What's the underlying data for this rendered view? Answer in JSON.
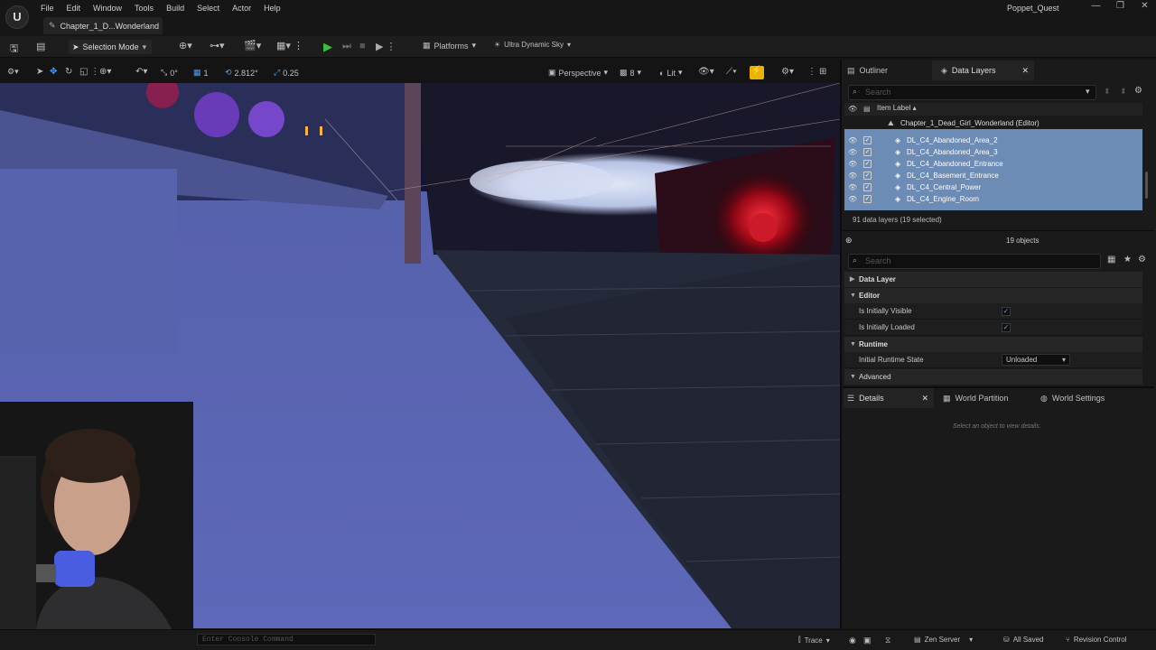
{
  "app": {
    "project_name": "Poppet_Quest",
    "level_tab": "Chapter_1_D...Wonderland",
    "logo_icon": "unreal-logo"
  },
  "menu": [
    "File",
    "Edit",
    "Window",
    "Tools",
    "Build",
    "Select",
    "Actor",
    "Help"
  ],
  "toolbar": {
    "selection_mode": "Selection Mode",
    "platforms": "Platforms",
    "sky": "Ultra Dynamic Sky"
  },
  "viewport_toolbar": {
    "rotation_snap": "0°",
    "grid_snap": "1",
    "angle_snap": "2.812°",
    "scale_snap": "0.25",
    "perspective": "Perspective",
    "camera_speed": "8",
    "view_mode": "Lit"
  },
  "outliner_tabs": {
    "outliner": "Outliner",
    "data_layers": "Data Layers"
  },
  "data_layers": {
    "search_placeholder": "Search",
    "column": "Item Label ▴",
    "world": "Chapter_1_Dead_Girl_Wonderland (Editor)",
    "items": [
      "DL_C4_Abandoned_Area_2",
      "DL_C4_Abandoned_Area_3",
      "DL_C4_Abandoned_Entrance",
      "DL_C4_Basement_Entrance",
      "DL_C4_Central_Power",
      "DL_C4_Engine_Room"
    ],
    "status": "91 data layers (19 selected)"
  },
  "layer_details": {
    "objects": "19 objects",
    "search_placeholder": "Search",
    "cat_data_layer": "Data Layer",
    "cat_editor": "Editor",
    "prop_visible": "Is Initially Visible",
    "prop_loaded": "Is Initially Loaded",
    "cat_runtime": "Runtime",
    "prop_runtime_state": "Initial Runtime State",
    "runtime_state_value": "Unloaded",
    "cat_advanced": "Advanced"
  },
  "details_tabs": {
    "details": "Details",
    "world_partition": "World Partition",
    "world_settings": "World Settings",
    "empty_message": "Select an object to view details."
  },
  "statusbar": {
    "console_placeholder": "Enter Console Command",
    "trace": "Trace",
    "zen": "Zen Server",
    "saved": "All Saved",
    "revision": "Revision Control"
  },
  "colors": {
    "selection": "#6c8bb5",
    "viewport_floor": "#5c66b4",
    "play_green": "#3cbf3c",
    "accent_yellow": "#e8b400"
  }
}
